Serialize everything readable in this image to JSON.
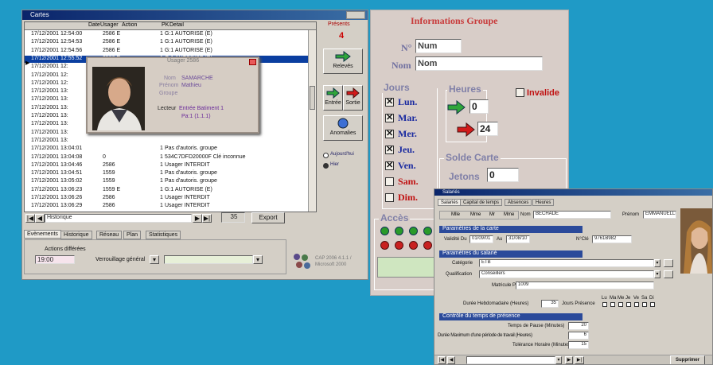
{
  "main_window": {
    "title": "Cartes",
    "columns": [
      "Date",
      "Usager",
      "Action",
      "PK",
      "Detail"
    ],
    "rows": [
      {
        "date": "17/12/2001 12:54:00",
        "usager": "2586 E",
        "action": "",
        "pk": "1",
        "detail": "G:1 AUTORISE (E)"
      },
      {
        "date": "17/12/2001 12:54:53",
        "usager": "2586 E",
        "action": "",
        "pk": "1",
        "detail": "G:1 AUTORISE (E)"
      },
      {
        "date": "17/12/2001 12:54:56",
        "usager": "2586 E",
        "action": "",
        "pk": "1",
        "detail": "G:1 AUTORISE (E)"
      },
      {
        "date": "17/12/2001 12:55:52",
        "usager": "2586 E",
        "action": "",
        "pk": "1",
        "detail": "G:1 AUTORISE (E)"
      },
      {
        "date": "17/12/2001 12:",
        "usager": "",
        "action": "",
        "pk": "",
        "detail": ""
      },
      {
        "date": "17/12/2001 12:",
        "usager": "",
        "action": "",
        "pk": "",
        "detail": ""
      },
      {
        "date": "17/12/2001 12:",
        "usager": "",
        "action": "",
        "pk": "",
        "detail": ""
      },
      {
        "date": "17/12/2001 13:",
        "usager": "",
        "action": "",
        "pk": "",
        "detail": ""
      },
      {
        "date": "17/12/2001 13:",
        "usager": "",
        "action": "",
        "pk": "",
        "detail": ""
      },
      {
        "date": "17/12/2001 13:",
        "usager": "",
        "action": "",
        "pk": "",
        "detail": ""
      },
      {
        "date": "17/12/2001 13:",
        "usager": "",
        "action": "",
        "pk": "",
        "detail": ""
      },
      {
        "date": "17/12/2001 13:",
        "usager": "",
        "action": "",
        "pk": "",
        "detail": ""
      },
      {
        "date": "17/12/2001 13:",
        "usager": "",
        "action": "",
        "pk": "",
        "detail": ""
      },
      {
        "date": "17/12/2001 13:",
        "usager": "",
        "action": "",
        "pk": "",
        "detail": ""
      },
      {
        "date": "17/12/2001 13:04:01",
        "usager": "",
        "action": "",
        "pk": "1",
        "detail": "Pas d'autoris. groupe"
      },
      {
        "date": "17/12/2001 13:04:08",
        "usager": "0",
        "action": "",
        "pk": "1",
        "detail": "534C7DFD20000F Clé inconnue"
      },
      {
        "date": "17/12/2001 13:04:46",
        "usager": "2586",
        "action": "",
        "pk": "1",
        "detail": "Usager INTERDIT"
      },
      {
        "date": "17/12/2001 13:04:51",
        "usager": "1559",
        "action": "",
        "pk": "1",
        "detail": "Pas d'autoris. groupe"
      },
      {
        "date": "17/12/2001 13:05:02",
        "usager": "1559",
        "action": "",
        "pk": "1",
        "detail": "Pas d'autoris. groupe"
      },
      {
        "date": "17/12/2001 13:06:23",
        "usager": "1559 E",
        "action": "",
        "pk": "1",
        "detail": "G:1 AUTORISE (E)"
      },
      {
        "date": "17/12/2001 13:06:26",
        "usager": "2586",
        "action": "",
        "pk": "1",
        "detail": "Usager INTERDIT"
      },
      {
        "date": "17/12/2001 13:06:29",
        "usager": "2586",
        "action": "",
        "pk": "1",
        "detail": "Usager INTERDIT"
      }
    ],
    "popup": {
      "title": "Usager 2586",
      "nom_label": "Nom",
      "nom_value": "SAMARCHE",
      "prenom_label": "Prénom",
      "prenom_value": "Mathieu",
      "groupe_label": "Groupe",
      "lecteur_label": "Lecteur",
      "lecteur_value": "Entrée Batiment 1",
      "pa_value": "Pa:1    (1.1.1)"
    },
    "side_buttons": {
      "presents": "Présents",
      "present_count": "4",
      "releves": "Relevés",
      "entree": "Entrée",
      "sortie": "Sortie",
      "anomalies": "Anomalies",
      "radio1": "Aujourd'hui",
      "radio2": "Hier"
    },
    "nav": {
      "filter_value": "Historique",
      "count": "35",
      "export": "Export"
    },
    "tabs": [
      "Evènements",
      "Historique",
      "Réseau",
      "Plan",
      "Statistiques"
    ],
    "actions": {
      "label": "Actions différées",
      "time": "19:00",
      "mode": "Verrouillage général"
    },
    "footer": {
      "logo_text": "CAP 2006 4.1.1 / Microsoft 2000"
    }
  },
  "group_panel": {
    "title": "Informations Groupe",
    "no_label": "N°",
    "no_value": "Num",
    "nom_label": "Nom",
    "nom_value": "Nom",
    "jours_title": "Jours",
    "days": [
      {
        "label": "Lun.",
        "checked": true,
        "red": false
      },
      {
        "label": "Mar.",
        "checked": true,
        "red": false
      },
      {
        "label": "Mer.",
        "checked": true,
        "red": false
      },
      {
        "label": "Jeu.",
        "checked": true,
        "red": false
      },
      {
        "label": "Ven.",
        "checked": true,
        "red": false
      },
      {
        "label": "Sam.",
        "checked": false,
        "red": true
      },
      {
        "label": "Dim.",
        "checked": false,
        "red": true
      }
    ],
    "heures_title": "Heures",
    "heure_in": "0",
    "heure_out": "24",
    "invalid_label": "Invalide",
    "solde_title": "Solde Carte",
    "jetons_label": "Jetons",
    "jetons_value": "0",
    "acces_title": "Accès"
  },
  "salaries_window": {
    "title": "Salariés",
    "tabs": [
      "Salariés",
      "Capital de temps",
      "Absences",
      "Heures"
    ],
    "civilite": [
      "Mlle",
      "Mme",
      "Mr",
      "Mme"
    ],
    "nom_label": "Nom",
    "nom_value": "BECHADE",
    "prenom_label": "Prénom",
    "prenom_value": "EMMANUELLE",
    "carte_header": "Paramètres de la carte",
    "validite_label": "Validité Du",
    "validite_du": "01/09/01",
    "validite_au_label": "Au",
    "validite_au": "31/08/10",
    "ncle_label": "N°Clé",
    "ncle_value": "9761B982",
    "salarie_header": "Paramètres du salarié",
    "categorie_label": "Catégorie",
    "categorie_value": "ETB",
    "qualification_label": "Qualification",
    "qualification_value": "Conseillers",
    "matricule_label": "Matricule Paye",
    "matricule_value": "1009",
    "duree_label": "Durée Hebdomadaire (Heures)",
    "duree_value": "35",
    "jours_presence_label": "Jours Présence",
    "jours_presence": [
      "Lu",
      "Ma",
      "Me",
      "Je",
      "Ve",
      "Sa",
      "Di"
    ],
    "controle_header": "Contrôle du temps de présence",
    "pause_label": "Temps de Pause (Minutes)",
    "pause_value": "20",
    "periode_label": "Durée Maximum d'une période de travail (Heures)",
    "periode_value": "6",
    "tolerance_label": "Tolérance Horaire (Minutes)",
    "tolerance_value": "15",
    "supprimer": "Supprimer"
  },
  "colors": {
    "background": "#1f9ac6",
    "window": "#d4cfc6",
    "selection": "#0a3ea0",
    "day_blue": "#1a2aa0",
    "red": "#c01010",
    "green_arrow": "#2fa63a"
  },
  "icons": [
    "green-arrow-icon",
    "red-arrow-icon",
    "globe-icon",
    "network-logo-icon",
    "checkbox-icon",
    "led-icon"
  ]
}
